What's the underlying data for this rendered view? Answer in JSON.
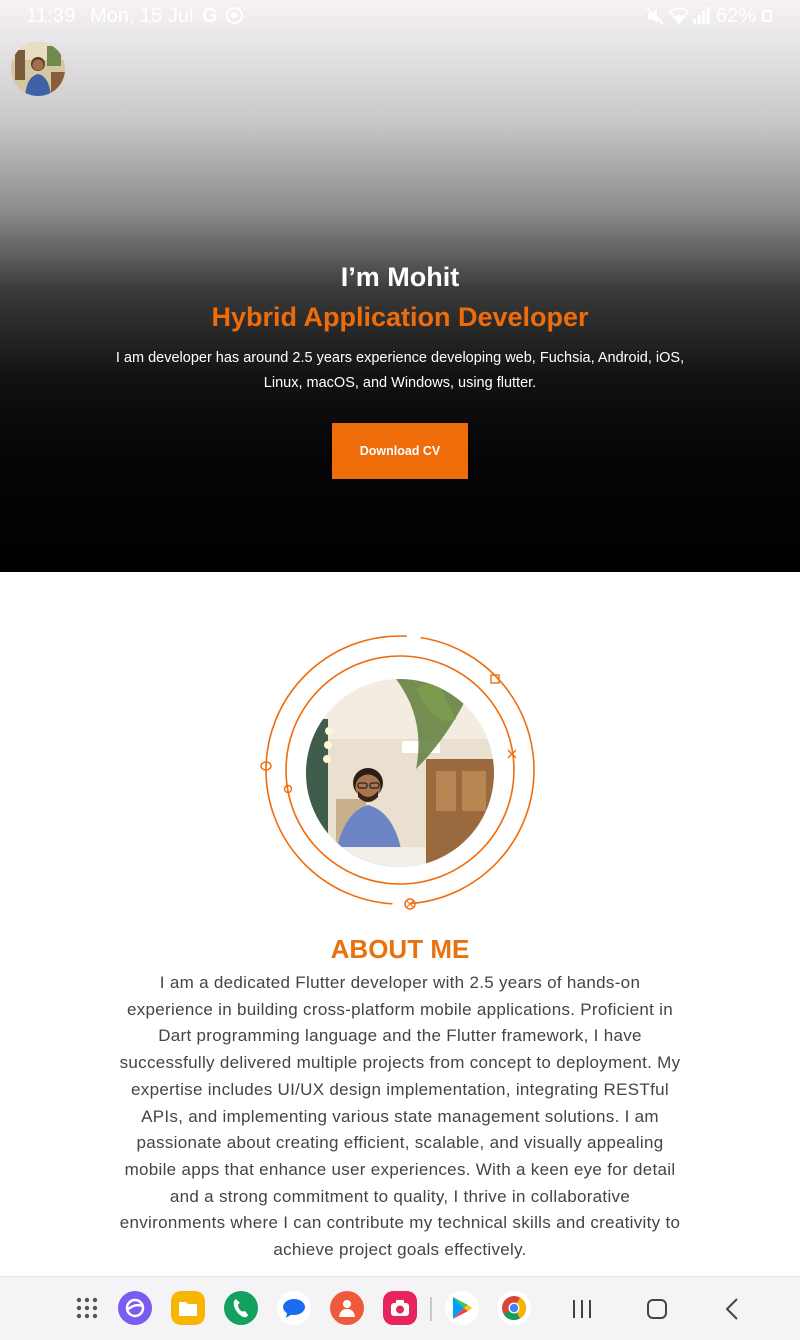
{
  "status_bar": {
    "time": "11:39",
    "date": "Mon, 15 Jul",
    "google_label": "G",
    "battery": "62%"
  },
  "hero": {
    "greeting": "I’m Mohit",
    "role": "Hybrid Application Developer",
    "description": "I am developer has around 2.5 years experience developing  web, Fuchsia, Android, iOS, Linux, macOS, and Windows, using flutter.",
    "download_button": "Download CV"
  },
  "about": {
    "title": "ABOUT ME",
    "text": "I am a dedicated Flutter developer with 2.5 years of hands-on experience in building cross-platform mobile applications. Proficient in Dart programming language and the Flutter framework, I have successfully delivered multiple projects from concept to deployment. My expertise includes UI/UX design implementation, integrating RESTful APIs, and implementing various state management solutions. I am passionate about creating efficient, scalable, and visually appealing mobile apps that enhance user experiences. With a keen eye for detail and a strong commitment to quality, I thrive in collaborative environments where I can contribute my technical skills and creativity to achieve project goals effectively."
  },
  "nav_bar": {
    "apps": [
      "apps-grid-icon",
      "browser-icon",
      "files-icon",
      "phone-icon",
      "messages-icon",
      "contacts-icon",
      "camera-icon",
      "play-store-icon",
      "chrome-icon"
    ],
    "system": [
      "recents-icon",
      "home-icon",
      "back-icon"
    ]
  },
  "colors": {
    "accent": "#ef6c0b",
    "hero_bg": "#000000",
    "body_text": "#444444"
  }
}
